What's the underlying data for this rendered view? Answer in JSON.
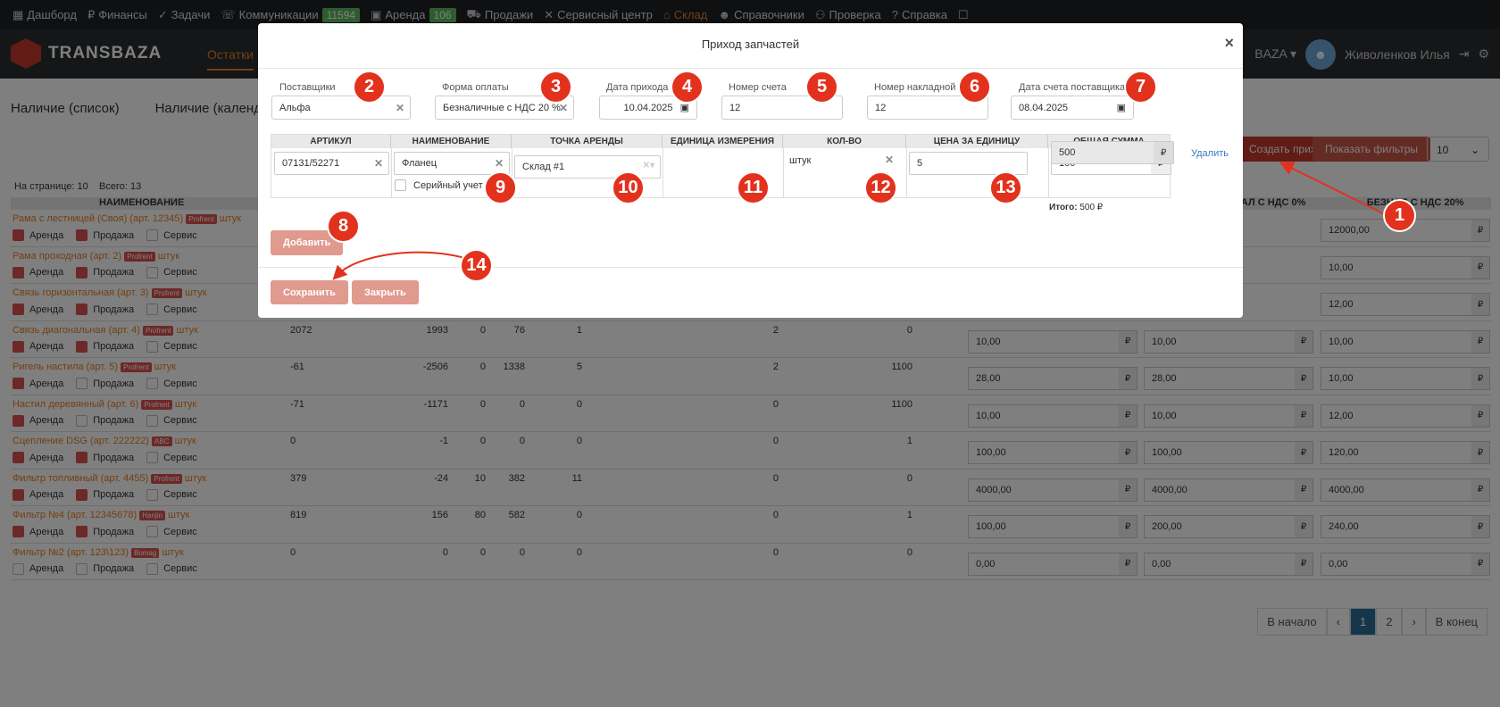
{
  "topnav": [
    {
      "icon": "dashboard-icon",
      "glyph": "▦",
      "label": "Дашборд",
      "badge": ""
    },
    {
      "icon": "ruble-icon",
      "glyph": "₽",
      "label": "Финансы",
      "badge": ""
    },
    {
      "icon": "check-circle-icon",
      "glyph": "✓",
      "label": "Задачи",
      "badge": ""
    },
    {
      "icon": "phone-icon",
      "glyph": "☏",
      "label": "Коммуникации",
      "badge": "11594"
    },
    {
      "icon": "briefcase-icon",
      "glyph": "▣",
      "label": "Аренда",
      "badge": "106"
    },
    {
      "icon": "cart-icon",
      "glyph": "⛟",
      "label": "Продажи",
      "badge": ""
    },
    {
      "icon": "tools-icon",
      "glyph": "✕",
      "label": "Сервисный центр",
      "badge": ""
    },
    {
      "icon": "warehouse-icon",
      "glyph": "⌂",
      "label": "Склад",
      "badge": ""
    },
    {
      "icon": "users-icon",
      "glyph": "☻",
      "label": "Справочники",
      "badge": ""
    },
    {
      "icon": "inspect-icon",
      "glyph": "⚇",
      "label": "Проверка",
      "badge": ""
    },
    {
      "icon": "help-icon",
      "glyph": "?",
      "label": "Справка",
      "badge": ""
    },
    {
      "icon": "chat-icon",
      "glyph": "☐",
      "label": "",
      "badge": ""
    }
  ],
  "header": {
    "logo": "TRANSBAZA",
    "tab_active": "Остатки",
    "company": "BAZA",
    "user": "Живоленков Илья"
  },
  "subtabs": [
    "Наличие (список)",
    "Наличие (календарь)"
  ],
  "page_info": {
    "per_page_label": "На странице: 10",
    "total_label": "Всего: 13"
  },
  "toolbar": {
    "add_income": "Создать приход",
    "show_filters": "Показать фильтры",
    "per_page": "10"
  },
  "bg_table": {
    "col_name": "НАИМЕНОВАНИЕ",
    "col_nds0": "БЕЗНАЛ С НДС 0%",
    "col_nds20": "БЕЗНАЛ С НДС 20%",
    "check_labels": [
      "Аренда",
      "Продажа",
      "Сервис"
    ],
    "currency": "₽",
    "rows": [
      {
        "name": "Рама с лестницей (Своя) (арт. 12345)",
        "tag": "Profrent",
        "unit": "штук",
        "checks": [
          true,
          true,
          false
        ],
        "n": [
          "",
          "",
          "",
          "",
          "",
          "",
          ""
        ],
        "prices": [
          "",
          "",
          "12000,00"
        ]
      },
      {
        "name": "Рама проходная (арт. 2)",
        "tag": "Profrent",
        "unit": "штук",
        "checks": [
          true,
          true,
          false
        ],
        "n": [
          "",
          "",
          "",
          "",
          "",
          "",
          ""
        ],
        "prices": [
          "",
          "",
          "10,00"
        ]
      },
      {
        "name": "Связь горизонтальная (арт. 3)",
        "tag": "Profrent",
        "unit": "штук",
        "checks": [
          true,
          true,
          false
        ],
        "n": [
          "",
          "",
          "",
          "",
          "",
          "",
          ""
        ],
        "prices": [
          "",
          "",
          "12,00"
        ]
      },
      {
        "name": "Связь диагональная (арт. 4)",
        "tag": "Profrent",
        "unit": "штук",
        "checks": [
          true,
          true,
          false
        ],
        "n": [
          "2072",
          "1993",
          "0",
          "76",
          "1",
          "2",
          "0"
        ],
        "prices": [
          "10,00",
          "10,00",
          "10,00"
        ]
      },
      {
        "name": "Ригель настила (арт. 5)",
        "tag": "Profrent",
        "unit": "штук",
        "checks": [
          true,
          false,
          false
        ],
        "n": [
          "-61",
          "-2506",
          "0",
          "1338",
          "5",
          "2",
          "1100"
        ],
        "prices": [
          "28,00",
          "28,00",
          "10,00"
        ]
      },
      {
        "name": "Настил деревянный (арт. 6)",
        "tag": "Profrent",
        "unit": "штук",
        "checks": [
          true,
          false,
          false
        ],
        "n": [
          "-71",
          "-1171",
          "0",
          "0",
          "0",
          "0",
          "1100"
        ],
        "prices": [
          "10,00",
          "10,00",
          "12,00"
        ]
      },
      {
        "name": "Сцепление DSG (арт. 222222)",
        "tag": "ABC",
        "unit": "штук",
        "checks": [
          true,
          true,
          false
        ],
        "n": [
          "0",
          "-1",
          "0",
          "0",
          "0",
          "0",
          "1"
        ],
        "prices": [
          "100,00",
          "100,00",
          "120,00"
        ]
      },
      {
        "name": "Фильтр топливный (арт. 4455)",
        "tag": "Profrent",
        "unit": "штук",
        "checks": [
          true,
          true,
          false
        ],
        "n": [
          "379",
          "-24",
          "10",
          "382",
          "11",
          "0",
          "0"
        ],
        "prices": [
          "4000,00",
          "4000,00",
          "4000,00"
        ]
      },
      {
        "name": "Фильтр №4 (арт. 12345678)",
        "tag": "Hanjin",
        "unit": "штук",
        "checks": [
          true,
          true,
          false
        ],
        "n": [
          "819",
          "156",
          "80",
          "582",
          "0",
          "0",
          "1"
        ],
        "prices": [
          "100,00",
          "200,00",
          "240,00"
        ]
      },
      {
        "name": "Фильтр №2 (арт. 123\\123)",
        "tag": "Bomag",
        "unit": "штук",
        "checks": [
          false,
          false,
          false
        ],
        "n": [
          "0",
          "0",
          "0",
          "0",
          "0",
          "0",
          "0"
        ],
        "prices": [
          "0,00",
          "0,00",
          "0,00"
        ]
      }
    ]
  },
  "pager": {
    "first": "В начало",
    "prev": "‹",
    "p1": "1",
    "p2": "2",
    "next": "›",
    "last": "В конец"
  },
  "modal": {
    "title": "Приход запчастей",
    "supplier_label": "Поставщики",
    "supplier_value": "Альфа",
    "payment_label": "Форма оплаты",
    "payment_value": "Безналичные с НДС 20 %",
    "date_label": "Дата прихода",
    "date_value": "10.04.2025",
    "invoice_label": "Номер счета",
    "invoice_value": "12",
    "waybill_label": "Номер накладной",
    "waybill_value": "12",
    "supplier_date_label": "Дата счета поставщика",
    "supplier_date_value": "08.04.2025",
    "cols": [
      "АРТИКУЛ",
      "НАИМЕНОВАНИЕ",
      "ТОЧКА АРЕНДЫ",
      "ЕДИНИЦА ИЗМЕРЕНИЯ",
      "КОЛ-ВО",
      "ЦЕНА ЗА ЕДИНИЦУ",
      "ОБЩАЯ СУММА"
    ],
    "item": {
      "article": "07131/52271",
      "name": "Фланец",
      "serial_label": "Серийный учет",
      "point": "Склад #1",
      "unit": "штук",
      "qty": "5",
      "price": "100",
      "total": "500"
    },
    "delete_label": "Удалить",
    "total_label": "Итого:",
    "total_value": "500 ₽",
    "add_button": "Добавить",
    "save_button": "Сохранить",
    "close_button": "Закрыть"
  },
  "markers": [
    "1",
    "2",
    "3",
    "4",
    "5",
    "6",
    "7",
    "8",
    "9",
    "10",
    "11",
    "12",
    "13",
    "14"
  ],
  "colors": {
    "accent": "#e67e22",
    "marker": "#e2321d",
    "button": "#d9534f",
    "active_page": "#2d6f96"
  }
}
